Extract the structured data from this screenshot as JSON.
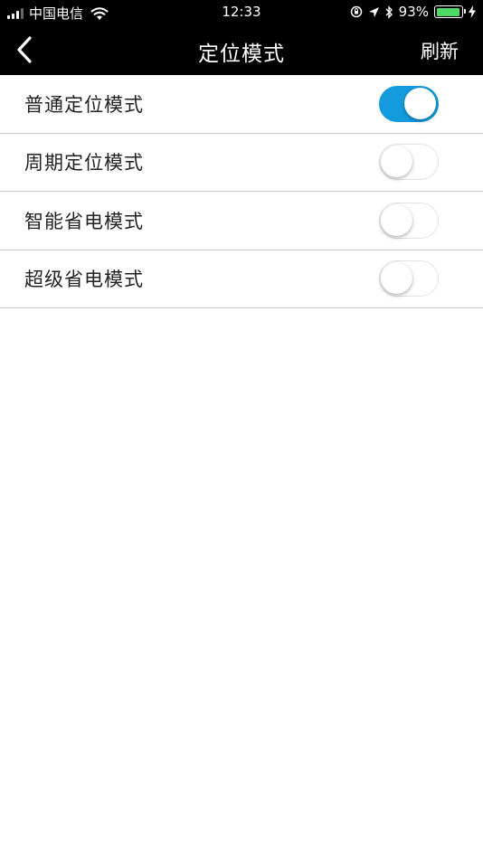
{
  "status_bar": {
    "carrier": "中国电信",
    "time": "12:33",
    "battery": "93%",
    "battery_level": 0.93
  },
  "nav": {
    "title": "定位模式",
    "refresh_label": "刷新",
    "back_icon": "chevron-left-icon"
  },
  "modes": [
    {
      "label": "普通定位模式",
      "enabled": true
    },
    {
      "label": "周期定位模式",
      "enabled": false
    },
    {
      "label": "智能省电模式",
      "enabled": false
    },
    {
      "label": "超级省电模式",
      "enabled": false
    }
  ],
  "colors": {
    "accent": "#139bde",
    "header": "#000000",
    "battery": "#4cd964"
  }
}
